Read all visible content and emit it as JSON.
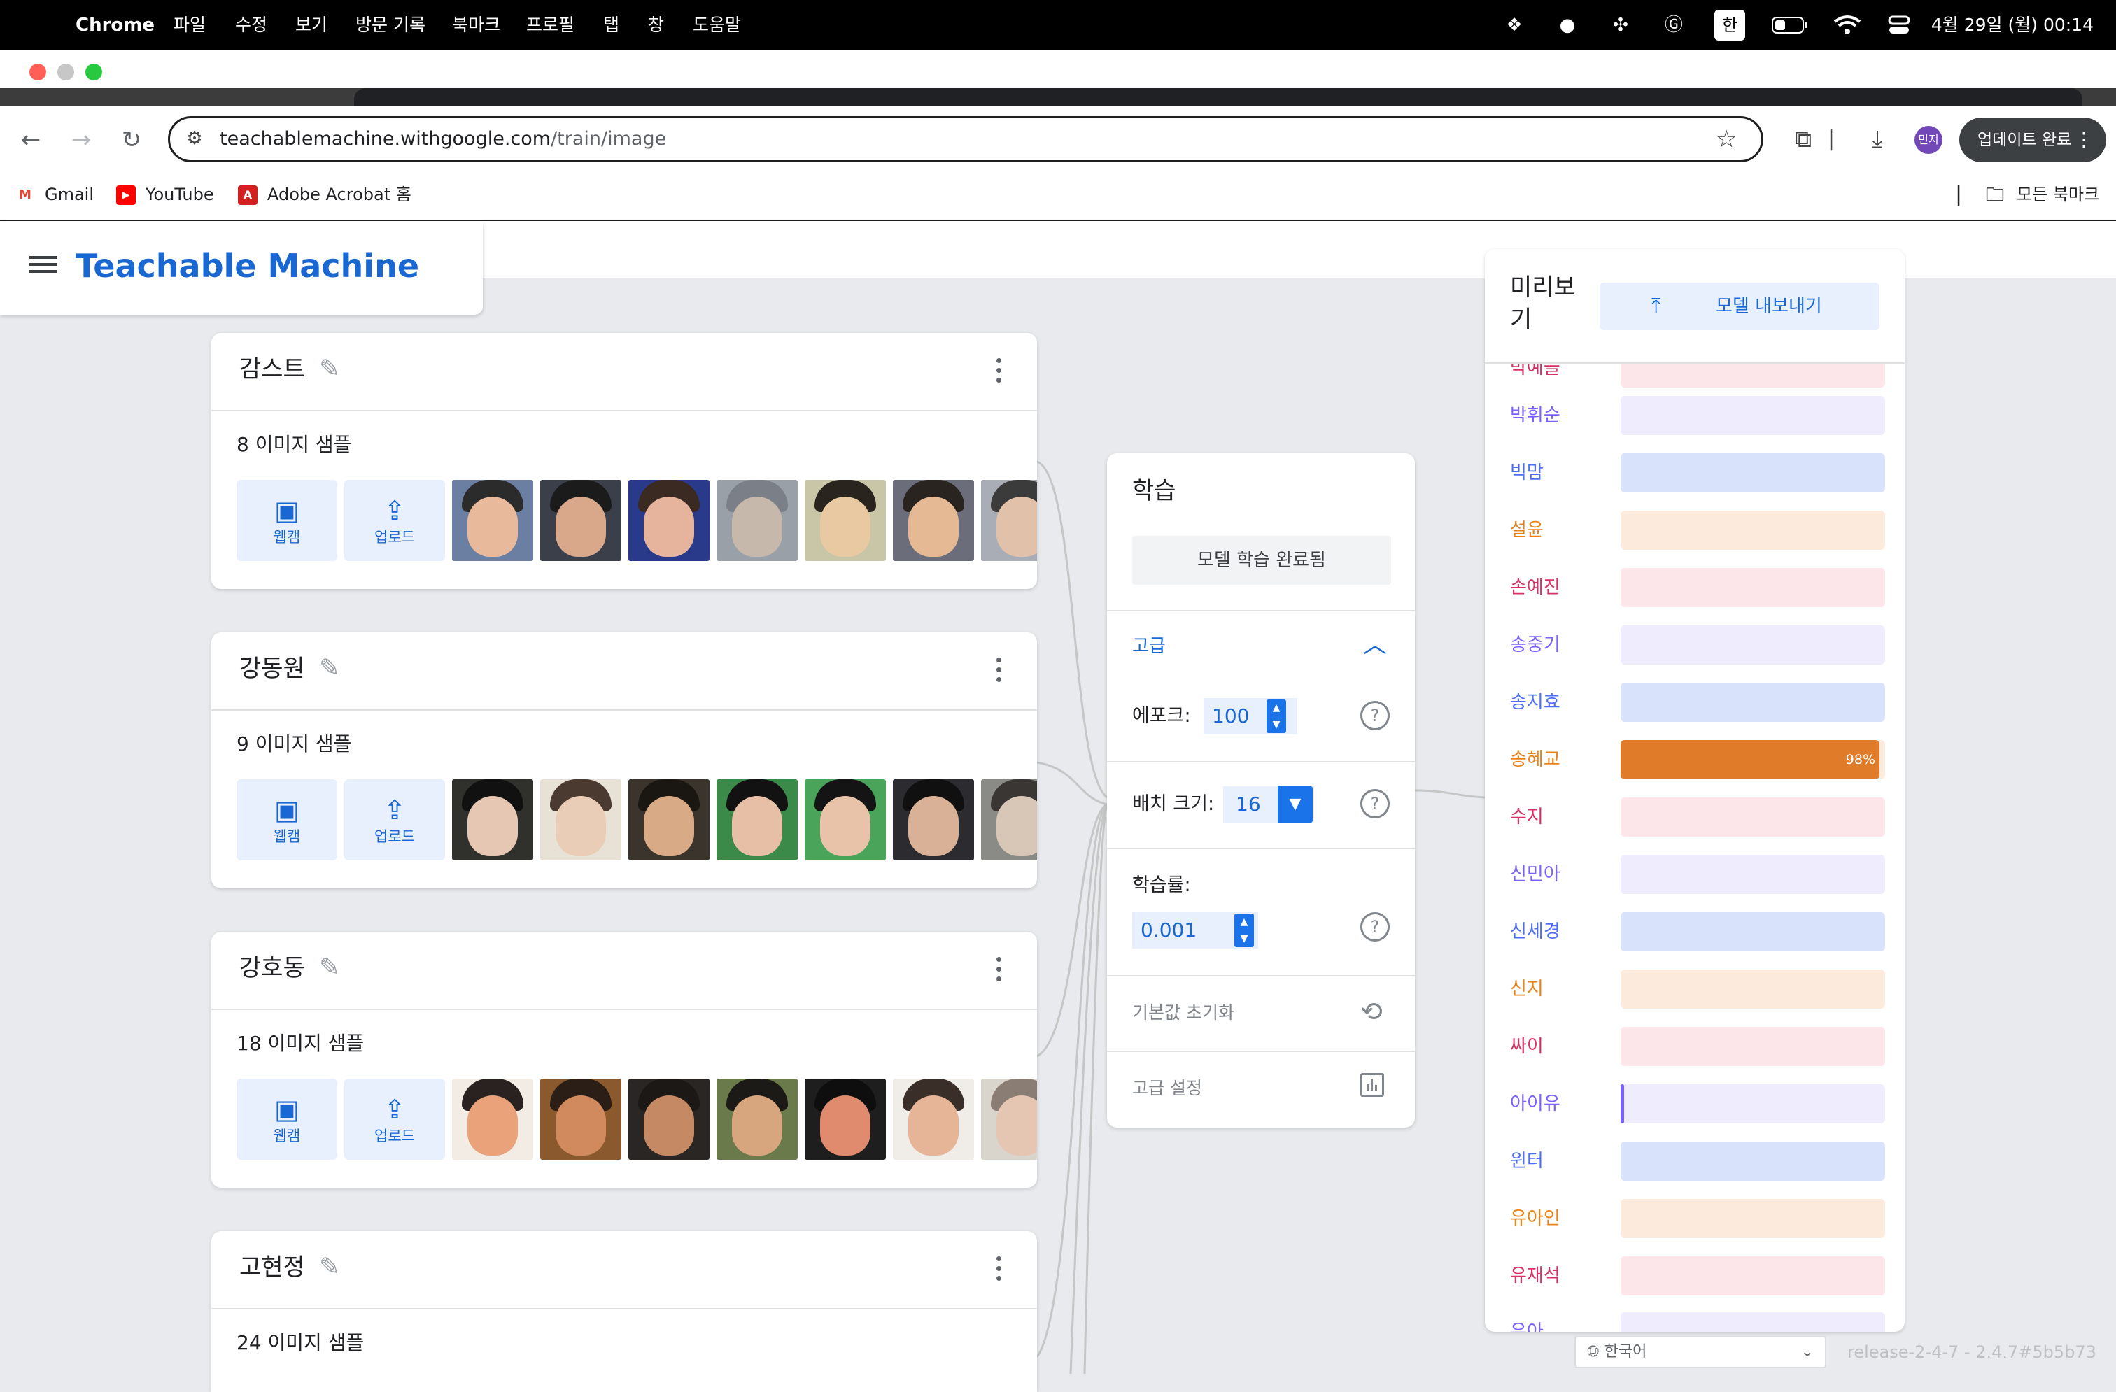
{
  "menubar": {
    "app_name": "Chrome",
    "items": [
      "파일",
      "수정",
      "보기",
      "방문 기록",
      "북마크",
      "프로필",
      "탭",
      "창",
      "도움말"
    ],
    "ime_label": "한",
    "clock": "4월 29일 (월) 00:14"
  },
  "browser": {
    "url_host": "teachablemachine.withgoogle.com",
    "url_path": "/train/image",
    "profile_initials": "민지",
    "update_label": "업데이트 완료",
    "bookmarks": [
      "Gmail",
      "YouTube",
      "Adobe Acrobat 홈"
    ],
    "all_bookmarks_label": "모든 북마크"
  },
  "app": {
    "title": "Teachable Machine"
  },
  "classes": [
    {
      "name": "감스트",
      "samples": "8 이미지 샘플"
    },
    {
      "name": "강동원",
      "samples": "9 이미지 샘플"
    },
    {
      "name": "강호동",
      "samples": "18 이미지 샘플"
    },
    {
      "name": "고현정",
      "samples": "24 이미지 샘플"
    }
  ],
  "sample_buttons": {
    "webcam": "웹캠",
    "upload": "업로드"
  },
  "training": {
    "title": "학습",
    "train_status": "모델 학습 완료됨",
    "advanced_label": "고급",
    "epochs_label": "에포크:",
    "epochs_value": "100",
    "batch_label": "배치 크기:",
    "batch_value": "16",
    "lr_label": "학습률:",
    "lr_value": "0.001",
    "reset_label": "기본값 초기화",
    "advanced_settings_label": "고급 설정"
  },
  "preview": {
    "title": "미리보\n기",
    "export_label": "모델 내보내기",
    "partial_top": "박예슬",
    "partial_bottom": "유아",
    "rows": [
      {
        "name": "박휘순",
        "color": "#7b61ff",
        "bg": "#efedfd",
        "value": 0
      },
      {
        "name": "빅맘",
        "color": "#4f6ef7",
        "bg": "#d8e3fb",
        "value": 0
      },
      {
        "name": "설윤",
        "color": "#e8831a",
        "bg": "#fcebdd",
        "value": 0
      },
      {
        "name": "손예진",
        "color": "#d93165",
        "bg": "#fce6ea",
        "value": 0
      },
      {
        "name": "송중기",
        "color": "#7b61ff",
        "bg": "#efedfd",
        "value": 0
      },
      {
        "name": "송지효",
        "color": "#4f6ef7",
        "bg": "#d8e3fb",
        "value": 0
      },
      {
        "name": "송혜교",
        "color": "#e8831a",
        "bg": "#fcebdd",
        "value": 0.98,
        "fill": "#e07b2a",
        "label": "98%"
      },
      {
        "name": "수지",
        "color": "#d93165",
        "bg": "#fce6ea",
        "value": 0
      },
      {
        "name": "신민아",
        "color": "#7b61ff",
        "bg": "#efedfd",
        "value": 0
      },
      {
        "name": "신세경",
        "color": "#4f6ef7",
        "bg": "#d8e3fb",
        "value": 0
      },
      {
        "name": "신지",
        "color": "#e8831a",
        "bg": "#fcebdd",
        "value": 0
      },
      {
        "name": "싸이",
        "color": "#d93165",
        "bg": "#fce6ea",
        "value": 0
      },
      {
        "name": "아이유",
        "color": "#7b61ff",
        "bg": "#efedfd",
        "value": 0.01,
        "fill": "#7b61ff"
      },
      {
        "name": "윈터",
        "color": "#4f6ef7",
        "bg": "#d8e3fb",
        "value": 0
      },
      {
        "name": "유아인",
        "color": "#e8831a",
        "bg": "#fcebdd",
        "value": 0
      },
      {
        "name": "유재석",
        "color": "#d93165",
        "bg": "#fce6ea",
        "value": 0
      }
    ]
  },
  "footer": {
    "language": "한국어",
    "release": "release-2-4-7 - 2.4.7#5b5b73"
  }
}
